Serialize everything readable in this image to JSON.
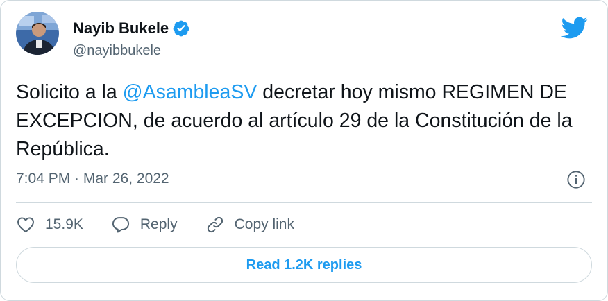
{
  "author": {
    "name": "Nayib Bukele",
    "handle": "@nayibbukele",
    "verified": true,
    "avatar_icon": "profile-photo"
  },
  "tweet": {
    "text_before": "Solicito a la ",
    "mention": "@AsambleaSV",
    "text_after": " decretar hoy mismo REGIMEN DE EXCEPCION, de acuerdo al artículo 29 de la Constitución de la República.",
    "timestamp": "7:04 PM · Mar 26, 2022"
  },
  "actions": {
    "like_count": "15.9K",
    "reply_label": "Reply",
    "copy_link_label": "Copy link"
  },
  "replies_button": "Read 1.2K replies",
  "icons": {
    "brand": "twitter-bird-icon",
    "verified": "verified-badge-icon",
    "info": "info-icon",
    "like": "heart-icon",
    "reply": "speech-bubble-icon",
    "copy": "link-icon"
  },
  "colors": {
    "accent": "#1d9bf0",
    "text": "#0f1419",
    "muted": "#536471",
    "border": "#cfd9de"
  }
}
